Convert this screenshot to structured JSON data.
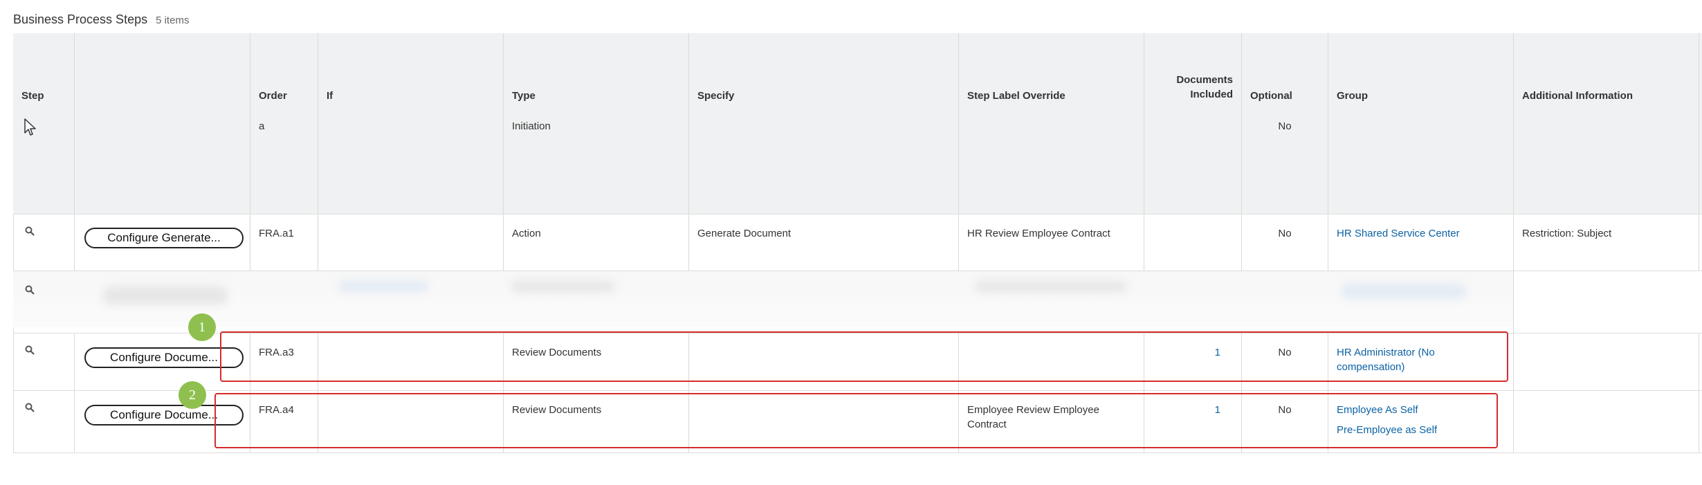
{
  "title": "Business Process Steps",
  "count": "5 items",
  "headers": {
    "step": "Step",
    "order": "Order",
    "if": "If",
    "type": "Type",
    "specify": "Specify",
    "label_override": "Step Label Override",
    "documents_included": "Documents Included",
    "optional": "Optional",
    "group": "Group",
    "additional_info": "Additional Information"
  },
  "rows": [
    {
      "order": "a",
      "type": "Initiation",
      "optional": "No"
    },
    {
      "button": "Configure Generate...",
      "order": "FRA.a1",
      "type": "Action",
      "specify": "Generate Document",
      "label_override": "HR Review Employee Contract",
      "optional": "No",
      "group": "HR Shared Service Center",
      "additional_info": "Restriction: Subject"
    },
    {
      "blurred": true
    },
    {
      "button": "Configure Docume...",
      "order": "FRA.a3",
      "type": "Review Documents",
      "documents_included": "1",
      "optional": "No",
      "group": "HR Administrator (No compensation)"
    },
    {
      "button": "Configure Docume...",
      "order": "FRA.a4",
      "type": "Review Documents",
      "label_override": "Employee Review Employee Contract",
      "documents_included": "1",
      "optional": "No",
      "group_lines": [
        "Employee As Self",
        "Pre-Employee as Self"
      ]
    }
  ],
  "annotations": [
    {
      "label": "1"
    },
    {
      "label": "2"
    }
  ],
  "colors": {
    "highlight": "#d62b2b",
    "badge": "#8fc04f",
    "link": "#0b62a4",
    "header_bg": "#f0f1f2"
  },
  "icons": {
    "row_search": "magnifier-icon",
    "cursor": "mouse-pointer-icon"
  }
}
